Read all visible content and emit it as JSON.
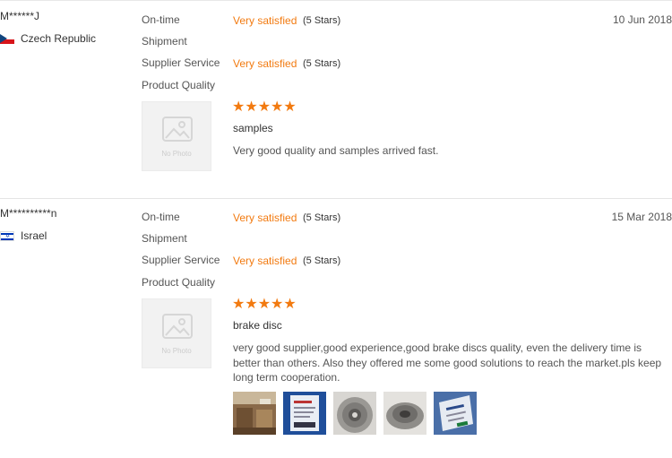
{
  "reviews": [
    {
      "buyer": "M******J",
      "country": "Czech Republic",
      "date": "10 Jun 2018",
      "criteria": [
        {
          "label": "On-time",
          "value": "Very satisfied",
          "stars": "(5 Stars)"
        },
        {
          "label": "Shipment",
          "value": "",
          "stars": ""
        },
        {
          "label": "Supplier Service",
          "value": "Very satisfied",
          "stars": "(5 Stars)"
        },
        {
          "label": "Product Quality",
          "value": "",
          "stars": ""
        }
      ],
      "rating": 5,
      "rating_glyphs": "★★★★★",
      "product_photo": "No Photo",
      "title": "samples",
      "text": "Very good quality and samples arrived fast."
    },
    {
      "buyer": "M**********n",
      "country": "Israel",
      "date": "15 Mar 2018",
      "criteria": [
        {
          "label": "On-time",
          "value": "Very satisfied",
          "stars": "(5 Stars)"
        },
        {
          "label": "Shipment",
          "value": "",
          "stars": ""
        },
        {
          "label": "Supplier Service",
          "value": "Very satisfied",
          "stars": "(5 Stars)"
        },
        {
          "label": "Product Quality",
          "value": "",
          "stars": ""
        }
      ],
      "rating": 5,
      "rating_glyphs": "★★★★★",
      "product_photo": "No Photo",
      "title": "brake disc",
      "text": "very good supplier,good experience,good brake discs quality, even the delivery time is better than others. Also they offered me some good solutions to reach the market.pls keep long term cooperation.",
      "photos": [
        "warehouse-photo",
        "box-label-photo",
        "brake-disc-photo",
        "brake-disc-photo-2",
        "package-label-photo"
      ]
    }
  ],
  "colors": {
    "accent": "#f27a10",
    "separator": "#e4e4e4"
  }
}
